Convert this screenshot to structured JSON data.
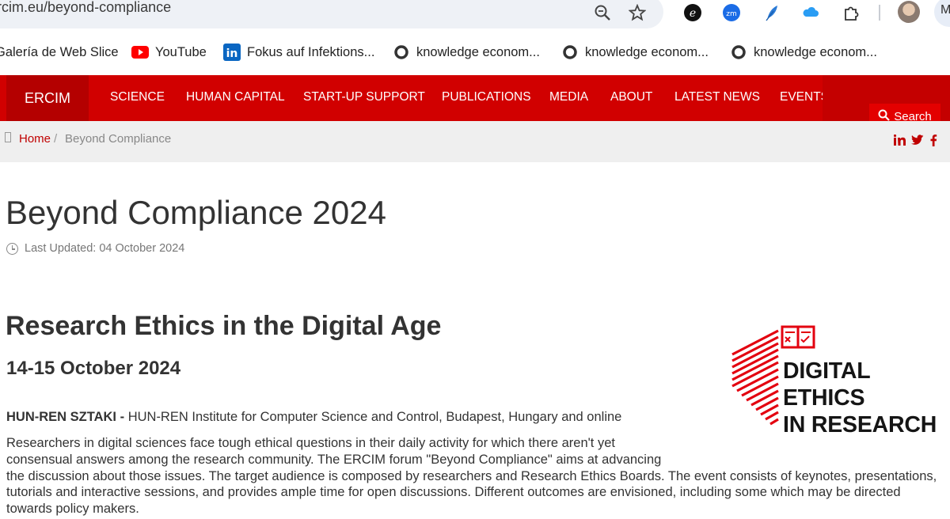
{
  "browser": {
    "url": "ercim.eu/beyond-compliance",
    "profile_initial": "M"
  },
  "bookmarks": [
    {
      "label": "Galería de Web Slice",
      "icon": "web-slice-icon"
    },
    {
      "label": "YouTube",
      "icon": "youtube-icon"
    },
    {
      "label": "Fokus auf Infektions...",
      "icon": "linkedin-icon"
    },
    {
      "label": "knowledge econom...",
      "icon": "globe-ring-icon"
    },
    {
      "label": "knowledge econom...",
      "icon": "globe-ring-icon"
    },
    {
      "label": "knowledge econom...",
      "icon": "globe-ring-icon"
    }
  ],
  "site_nav": {
    "brand": "ERCIM",
    "items": [
      "SCIENCE",
      "HUMAN CAPITAL",
      "START-UP SUPPORT",
      "PUBLICATIONS",
      "MEDIA",
      "ABOUT",
      "LATEST NEWS",
      "EVENTS"
    ],
    "search_label": "Search"
  },
  "breadcrumb": {
    "home": "Home",
    "separator": "/",
    "current": "Beyond Compliance"
  },
  "social": [
    "in",
    "twitter",
    "f"
  ],
  "article": {
    "title": "Beyond Compliance 2024",
    "last_updated": "Last Updated: 04 October 2024",
    "subtitle": "Research Ethics in the Digital Age",
    "date": "14-15 October 2024",
    "venue_org": "HUN-REN SZTAKI -",
    "venue_rest": " HUN-REN Institute for Computer Science and Control, Budapest, Hungary and online",
    "paragraph_lines": [
      "Researchers in digital sciences face tough ethical questions in their daily activity for which there aren't yet",
      "consensual answers among the research community. The ERCIM forum \"Beyond Compliance\" aims at advancing",
      "the discussion about those issues. The target audience is composed by researchers and Research Ethics Boards. The event consists of keynotes, presentations,",
      "tutorials and interactive sessions, and provides ample time for open discussions. Different outcomes are envisioned, including some which may be directed",
      "towards policy makers."
    ]
  },
  "logo": {
    "lines": [
      "DIGITAL",
      "ETHICS",
      "IN RESEARCH"
    ],
    "color": "#e3000f"
  },
  "colors": {
    "nav_red": "#d10000",
    "link_red": "#c00000"
  }
}
